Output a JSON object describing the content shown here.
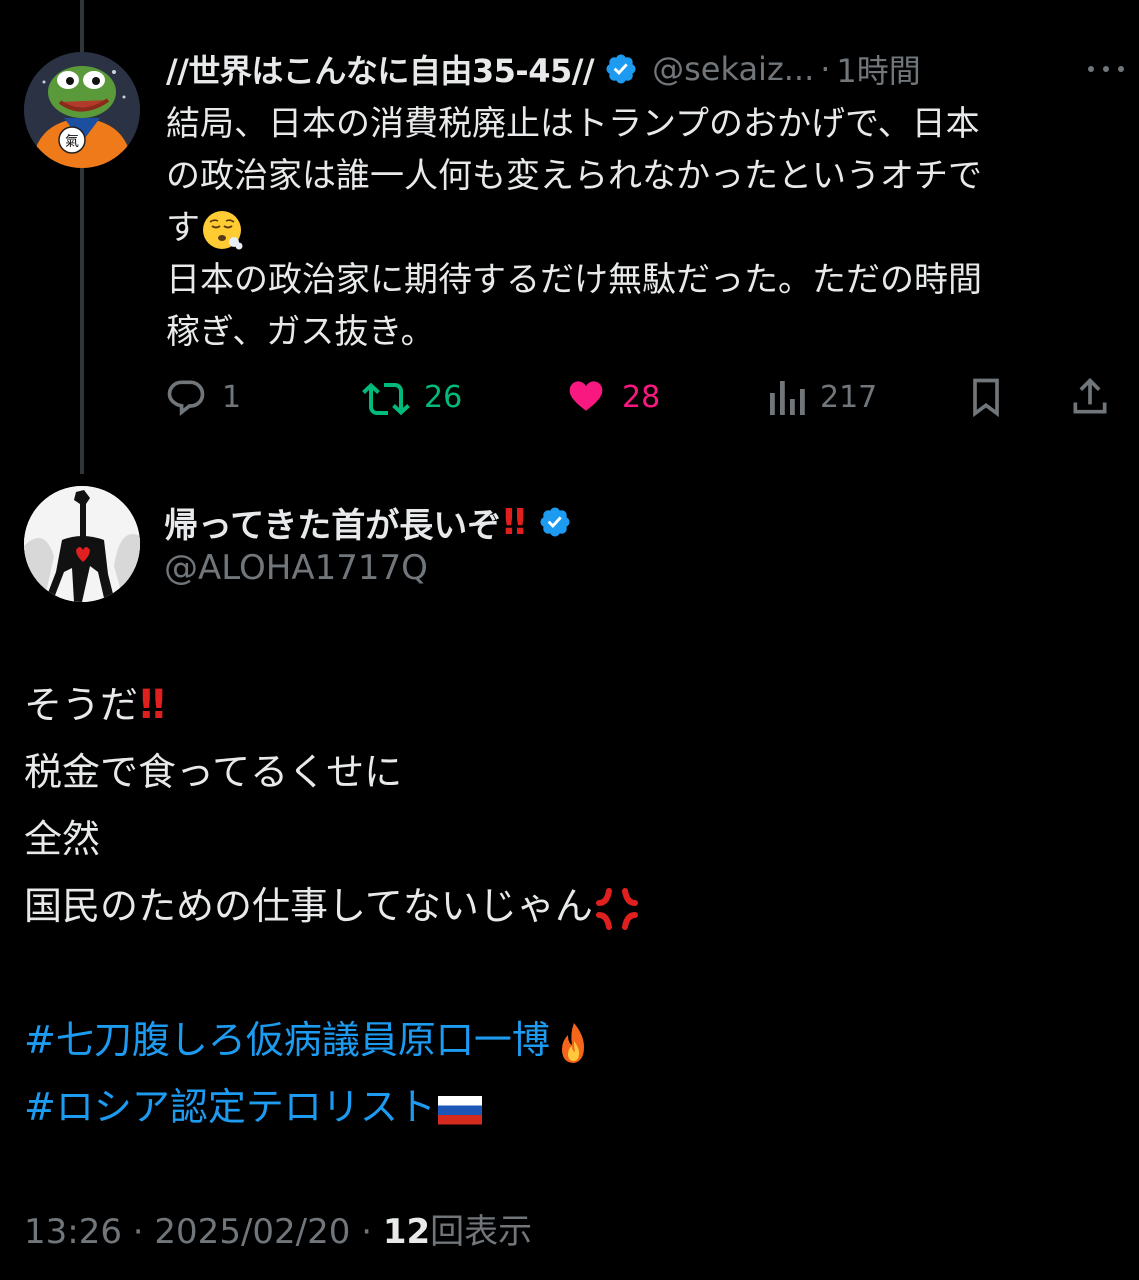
{
  "colors": {
    "background": "#000000",
    "text_primary": "#e7e9ea",
    "text_secondary": "#71767b",
    "link": "#1d9bf0",
    "retweet": "#00ba7c",
    "like": "#f91880",
    "verified": "#1d9bf0"
  },
  "parent_tweet": {
    "display_name": "//世界はこんなに自由35-45//",
    "handle": "@sekaiz...",
    "separator": "·",
    "time": "1時間",
    "verified_icon": "verified-badge-icon",
    "avatar_icon": "frog-avatar",
    "lines": [
      "結局、日本の消費税廃止はトランプのおかげで、日本",
      "の政治家は誰一人何も変えられなかったというオチで",
      "す",
      "日本の政治家に期待するだけ無駄だった。ただの時間",
      "稼ぎ、ガス抜き。"
    ],
    "emoji_after_line3": "face-exhaling-emoji",
    "actions": {
      "replies": "1",
      "retweets": "26",
      "likes": "28",
      "views": "217"
    }
  },
  "reply_tweet": {
    "display_name": "帰ってきた首が長いぞ",
    "exclamation": "‼",
    "handle": "@ALOHA1717Q",
    "verified_icon": "verified-badge-icon",
    "avatar_icon": "long-neck-figure-avatar",
    "lines": [
      "そうだ",
      "税金で食ってるくせに",
      "全然",
      "国民のための仕事してないじゃん"
    ],
    "line1_suffix": "‼",
    "anger_emoji": "anger-symbol-emoji",
    "hashtags": [
      "#七刀腹しろ仮病議員原口一博",
      "#ロシア認定テロリスト"
    ],
    "hashtag1_emoji": "fire-emoji",
    "hashtag2_emoji": "russia-flag-emoji",
    "time": "13:26",
    "date": "2025/02/20",
    "sep": "·",
    "view_count": "12",
    "view_label": "回表示"
  }
}
